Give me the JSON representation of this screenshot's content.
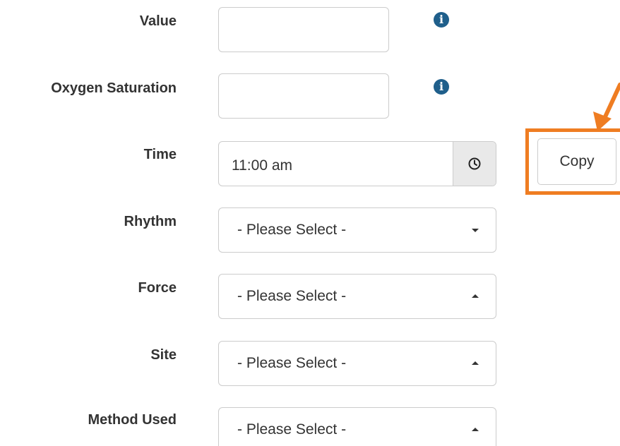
{
  "fields": {
    "value": {
      "label": "Value",
      "input_value": ""
    },
    "oxygen_saturation": {
      "label": "Oxygen Saturation",
      "input_value": ""
    },
    "time": {
      "label": "Time",
      "input_value": "11:00 am"
    },
    "rhythm": {
      "label": "Rhythm",
      "selected": "- Please Select -"
    },
    "force": {
      "label": "Force",
      "selected": "- Please Select -"
    },
    "site": {
      "label": "Site",
      "selected": "- Please Select -"
    },
    "method_used": {
      "label": "Method Used",
      "selected": "- Please Select -"
    }
  },
  "info_icon_glyph": "i",
  "copy_button": {
    "label": "Copy"
  },
  "colors": {
    "highlight": "#ef7d22",
    "info_icon": "#1f5f8b",
    "input_border": "#cccccc",
    "addon_background": "#e9e9e9"
  },
  "icons": {
    "info": "info-icon",
    "clock": "clock-icon",
    "caret_down": "caret-down-icon",
    "caret_up": "caret-up-icon",
    "arrow": "arrow-icon"
  }
}
